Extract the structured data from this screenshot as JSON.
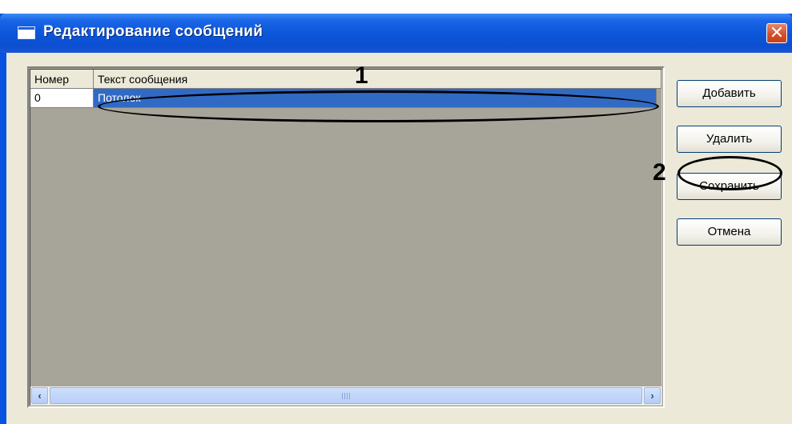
{
  "window": {
    "title": "Редактирование сообщений",
    "close_glyph": "✕"
  },
  "table": {
    "columns": [
      "Номер",
      "Текст сообщения"
    ],
    "rows": [
      {
        "number": "0",
        "text": "Потолок",
        "selected": true
      }
    ]
  },
  "buttons": {
    "add": "Добавить",
    "delete": "Удалить",
    "save": "Сохранить",
    "cancel": "Отмена"
  },
  "scrollbar": {
    "left_glyph": "‹",
    "right_glyph": "›"
  },
  "annotations": {
    "marker_1": "1",
    "marker_2": "2"
  },
  "colors": {
    "title_bar": "#0a55d8",
    "selection": "#316ac5",
    "grid_background": "#a7a599",
    "dialog_background": "#ece9d8"
  }
}
